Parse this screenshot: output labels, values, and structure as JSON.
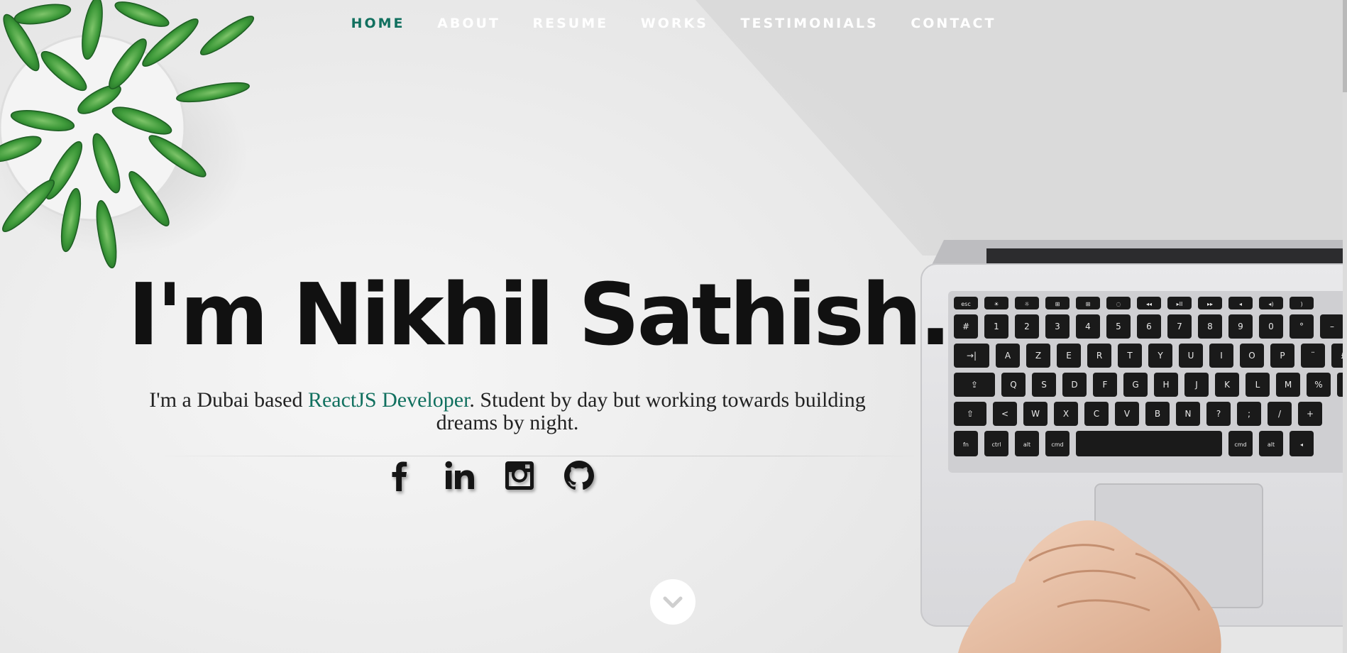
{
  "nav": {
    "items": [
      {
        "label": "HOME",
        "active": true
      },
      {
        "label": "ABOUT",
        "active": false
      },
      {
        "label": "RESUME",
        "active": false
      },
      {
        "label": "WORKS",
        "active": false
      },
      {
        "label": "TESTIMONIALS",
        "active": false
      },
      {
        "label": "CONTACT",
        "active": false
      }
    ]
  },
  "hero": {
    "headline": "I'm Nikhil Sathish.",
    "tagline_before": "I'm a Dubai based ",
    "tagline_highlight": "ReactJS Developer",
    "tagline_after": ". Student by day but working towards building dreams by night."
  },
  "social": [
    {
      "icon": "facebook-icon"
    },
    {
      "icon": "linkedin-icon"
    },
    {
      "icon": "instagram-icon"
    },
    {
      "icon": "github-icon"
    }
  ],
  "scroll_icon": "chevron-down-icon",
  "colors": {
    "accent": "#11705f",
    "nav_text": "#ffffff",
    "headline": "#111111",
    "tagline": "#222222",
    "icon": "#151515"
  },
  "background": {
    "description_icons": [
      "plant-image",
      "laptop-image",
      "hands-image"
    ]
  },
  "laptop_keys": {
    "row0": [
      "esc",
      "☀",
      "☼",
      "⊞",
      "⊞",
      "◌",
      "◂◂",
      "▸II",
      "▸▸",
      "◂",
      "◂)",
      ")"
    ],
    "row1": [
      "#",
      "1",
      "2",
      "3",
      "4",
      "5",
      "6",
      "7",
      "8",
      "9",
      "0",
      "°",
      "–"
    ],
    "row2": [
      "→|",
      "A",
      "Z",
      "E",
      "R",
      "T",
      "Y",
      "U",
      "I",
      "O",
      "P",
      "¨",
      "£"
    ],
    "row3": [
      "⇪",
      "Q",
      "S",
      "D",
      "F",
      "G",
      "H",
      "J",
      "K",
      "L",
      "M",
      "%",
      "`"
    ],
    "row4": [
      "⇧",
      "<",
      "W",
      "X",
      "C",
      "V",
      "B",
      "N",
      "?",
      ";",
      "/",
      "+"
    ],
    "row5": [
      "fn",
      "ctrl",
      "alt",
      "cmd",
      "cmd",
      "alt",
      "◂"
    ]
  }
}
